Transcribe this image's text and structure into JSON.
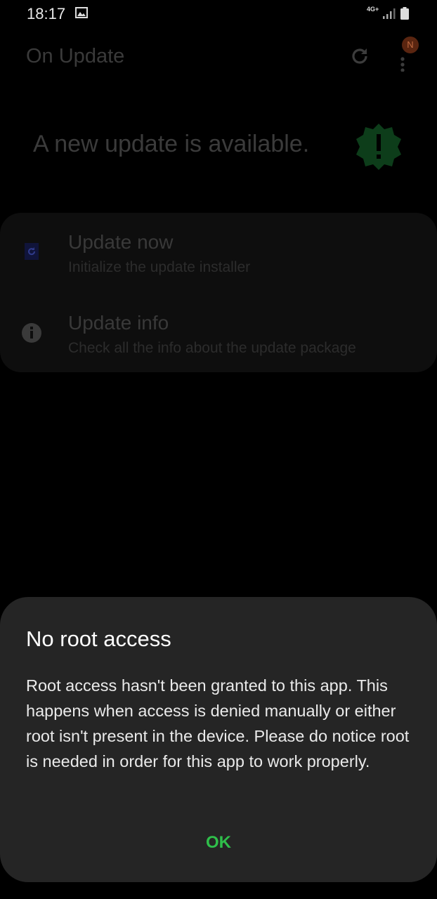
{
  "status_bar": {
    "time": "18:17",
    "network": "4G+",
    "icons": [
      "gallery-icon",
      "signal-icon",
      "battery-icon"
    ]
  },
  "app_bar": {
    "title": "On Update",
    "icons": [
      "refresh-icon",
      "more-vert-icon"
    ],
    "badge": "N"
  },
  "main": {
    "headline": "A new update is available.",
    "alert_icon": "alert-badge-icon",
    "accent_color": "#0d3d1a"
  },
  "menu": {
    "items": [
      {
        "title": "Update now",
        "subtitle": "Initialize the update installer",
        "icon": "update-installer-icon"
      },
      {
        "title": "Update info",
        "subtitle": "Check all the info about the update package",
        "icon": "info-icon"
      }
    ]
  },
  "dialog": {
    "title": "No root access",
    "message": "Root access hasn't been granted to this app. This happens when access is denied manually or either root isn't present in the device. Please do notice root is needed in order for this app to work properly.",
    "ok_label": "OK",
    "ok_color": "#2fbf4a"
  }
}
